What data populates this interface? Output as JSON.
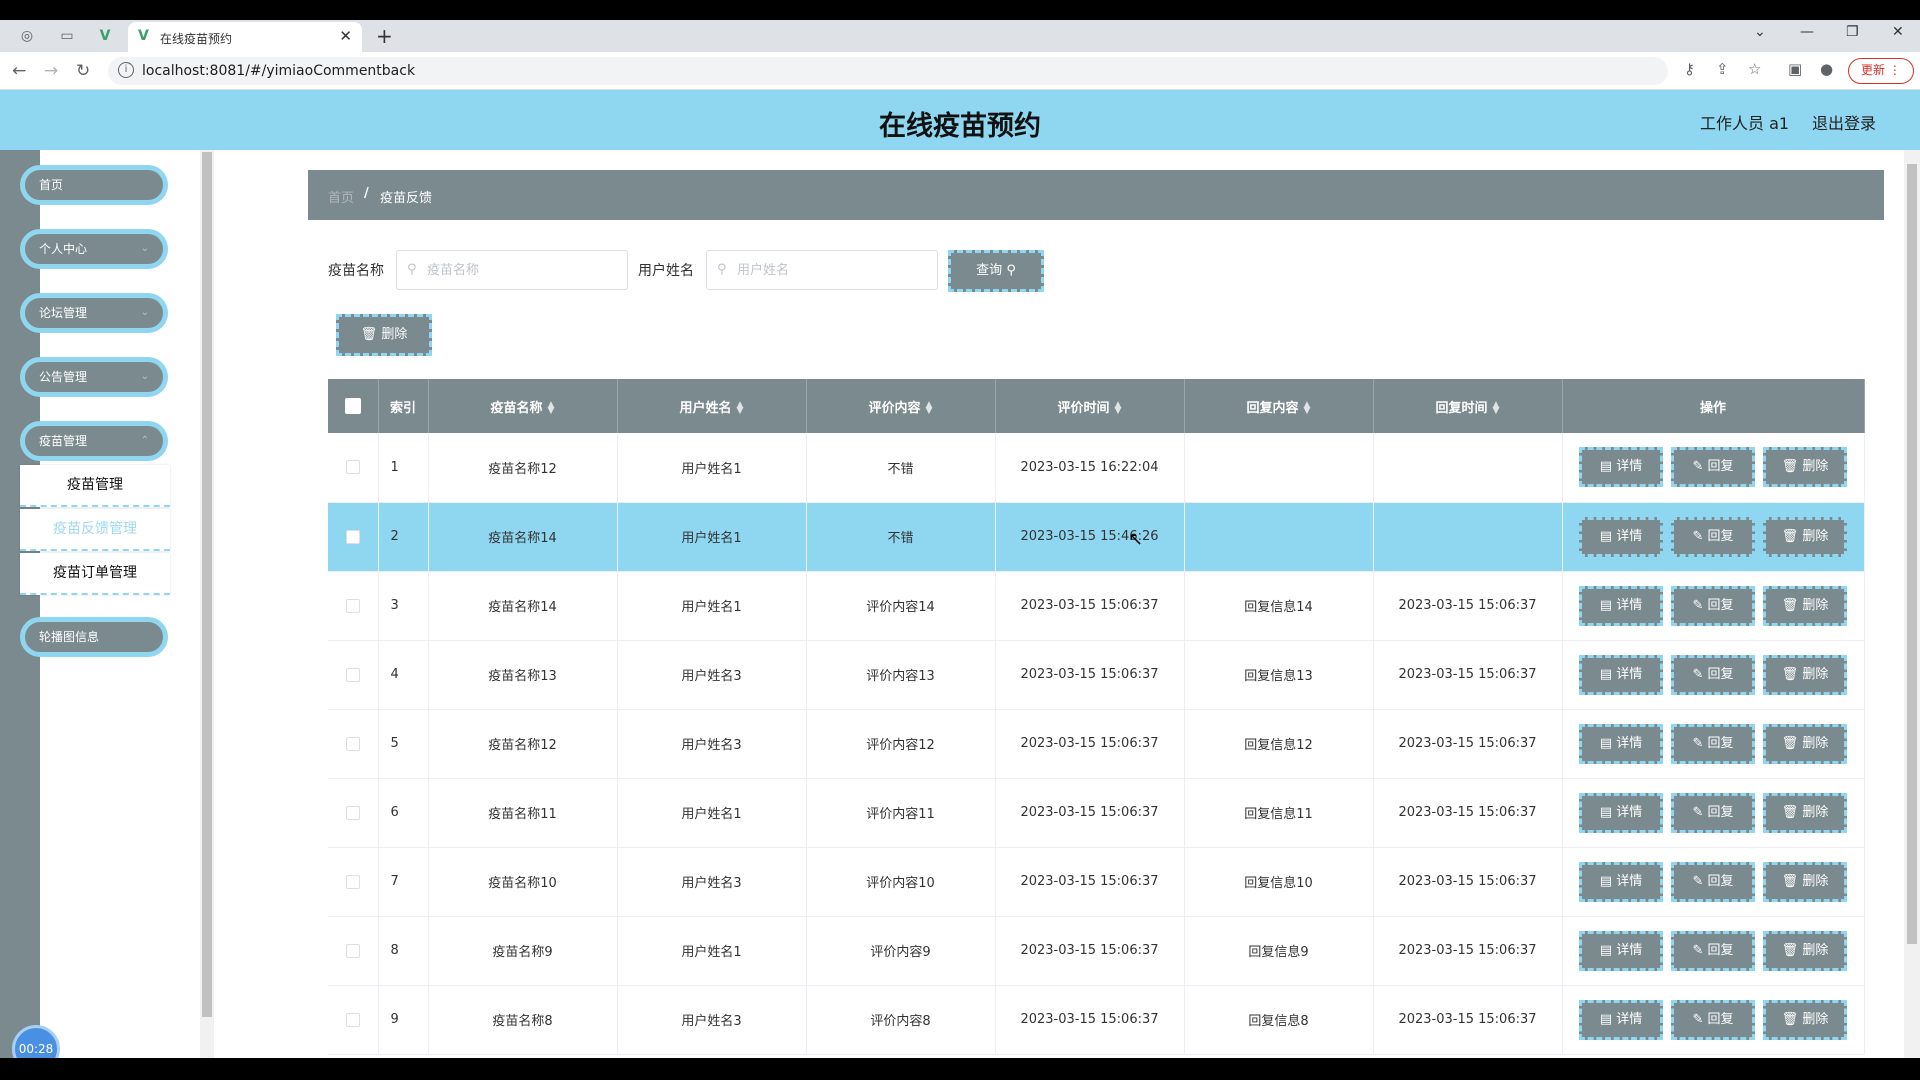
{
  "browser": {
    "tab_title": "在线疫苗预约",
    "url": "localhost:8081/#/yimiaoCommentback",
    "update_label": "更新"
  },
  "header": {
    "title": "在线疫苗预约",
    "user": "工作人员 a1",
    "logout": "退出登录"
  },
  "sidebar": {
    "items": [
      {
        "label": "首页"
      },
      {
        "label": "个人中心"
      },
      {
        "label": "论坛管理"
      },
      {
        "label": "公告管理"
      },
      {
        "label": "疫苗管理"
      },
      {
        "label": "轮播图信息"
      }
    ],
    "submenu": [
      {
        "label": "疫苗管理"
      },
      {
        "label": "疫苗反馈管理"
      },
      {
        "label": "疫苗订单管理"
      }
    ],
    "timer": "00:28"
  },
  "breadcrumb": {
    "home": "首页",
    "separator": "/",
    "current": "疫苗反馈"
  },
  "filters": {
    "vaccine_label": "疫苗名称",
    "vaccine_placeholder": "疫苗名称",
    "user_label": "用户姓名",
    "user_placeholder": "用户姓名",
    "search_label": "查询",
    "delete_label": "删除"
  },
  "table": {
    "headers": {
      "index": "索引",
      "vaccine": "疫苗名称",
      "user": "用户姓名",
      "comment": "评价内容",
      "comment_time": "评价时间",
      "reply": "回复内容",
      "reply_time": "回复时间",
      "actions": "操作"
    },
    "action_labels": {
      "detail": "详情",
      "reply": "回复",
      "delete": "删除"
    },
    "rows": [
      {
        "index": "1",
        "vaccine": "疫苗名称12",
        "user": "用户姓名1",
        "comment": "不错",
        "comment_time": "2023-03-15 16:22:04",
        "reply": "",
        "reply_time": ""
      },
      {
        "index": "2",
        "vaccine": "疫苗名称14",
        "user": "用户姓名1",
        "comment": "不错",
        "comment_time": "2023-03-15 15:46:26",
        "reply": "",
        "reply_time": ""
      },
      {
        "index": "3",
        "vaccine": "疫苗名称14",
        "user": "用户姓名1",
        "comment": "评价内容14",
        "comment_time": "2023-03-15 15:06:37",
        "reply": "回复信息14",
        "reply_time": "2023-03-15 15:06:37"
      },
      {
        "index": "4",
        "vaccine": "疫苗名称13",
        "user": "用户姓名3",
        "comment": "评价内容13",
        "comment_time": "2023-03-15 15:06:37",
        "reply": "回复信息13",
        "reply_time": "2023-03-15 15:06:37"
      },
      {
        "index": "5",
        "vaccine": "疫苗名称12",
        "user": "用户姓名3",
        "comment": "评价内容12",
        "comment_time": "2023-03-15 15:06:37",
        "reply": "回复信息12",
        "reply_time": "2023-03-15 15:06:37"
      },
      {
        "index": "6",
        "vaccine": "疫苗名称11",
        "user": "用户姓名1",
        "comment": "评价内容11",
        "comment_time": "2023-03-15 15:06:37",
        "reply": "回复信息11",
        "reply_time": "2023-03-15 15:06:37"
      },
      {
        "index": "7",
        "vaccine": "疫苗名称10",
        "user": "用户姓名3",
        "comment": "评价内容10",
        "comment_time": "2023-03-15 15:06:37",
        "reply": "回复信息10",
        "reply_time": "2023-03-15 15:06:37"
      },
      {
        "index": "8",
        "vaccine": "疫苗名称9",
        "user": "用户姓名1",
        "comment": "评价内容9",
        "comment_time": "2023-03-15 15:06:37",
        "reply": "回复信息9",
        "reply_time": "2023-03-15 15:06:37"
      },
      {
        "index": "9",
        "vaccine": "疫苗名称8",
        "user": "用户姓名3",
        "comment": "评价内容8",
        "comment_time": "2023-03-15 15:06:37",
        "reply": "回复信息8",
        "reply_time": "2023-03-15 15:06:37"
      }
    ]
  },
  "colors": {
    "accent": "#8fd7f0",
    "slate": "#7b8a8e"
  }
}
